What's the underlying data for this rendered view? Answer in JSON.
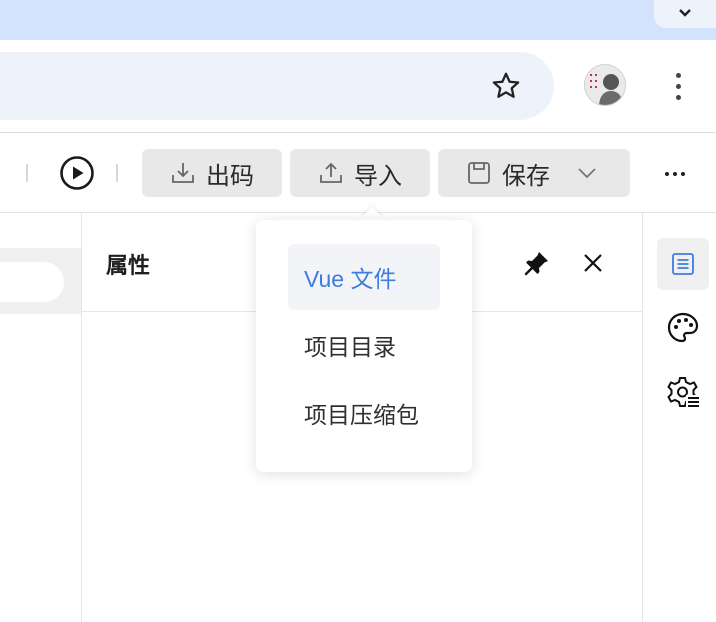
{
  "toolbar": {
    "export_label": "出码",
    "import_label": "导入",
    "save_label": "保存"
  },
  "properties_panel": {
    "title": "属性"
  },
  "import_menu": {
    "items": [
      {
        "label": "Vue 文件",
        "active": true
      },
      {
        "label": "项目目录",
        "active": false
      },
      {
        "label": "项目压缩包",
        "active": false
      }
    ]
  },
  "icons": {
    "bookmark": "star-icon",
    "play": "play-icon",
    "download": "download-icon",
    "upload": "upload-icon",
    "save": "save-icon",
    "pin": "pin-icon",
    "close": "close-icon",
    "rail": [
      "list-icon",
      "palette-icon",
      "settings-icon"
    ]
  },
  "colors": {
    "accent": "#3d7de0",
    "chrome_top": "#d3e3fd",
    "button_bg": "#e8e8e8"
  }
}
